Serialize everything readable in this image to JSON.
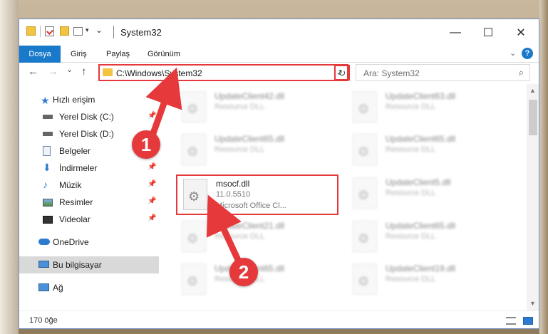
{
  "window": {
    "title": "System32",
    "minimize": "—",
    "maximize": "☐",
    "close": "✕"
  },
  "ribbon": {
    "tabs": [
      "Dosya",
      "Giriş",
      "Paylaş",
      "Görünüm"
    ],
    "active_tab": "Dosya",
    "expand_chevron": "⌄",
    "help": "?"
  },
  "navigation": {
    "back": "←",
    "forward": "→",
    "recent": "⌄",
    "up": "↑",
    "address_path": "C:\\Windows\\System32",
    "address_chevron": "⌄",
    "refresh": "↻",
    "search_placeholder": "Ara: System32",
    "search_icon": "⌕"
  },
  "sidebar": {
    "items": [
      {
        "label": "Hızlı erişim",
        "icon": "star-icon",
        "pinned": false
      },
      {
        "label": "Yerel Disk (C:)",
        "icon": "drive-icon",
        "pinned": true
      },
      {
        "label": "Yerel Disk (D:)",
        "icon": "drive-icon",
        "pinned": true
      },
      {
        "label": "Belgeler",
        "icon": "document-icon",
        "pinned": true
      },
      {
        "label": "İndirmeler",
        "icon": "download-icon",
        "pinned": true
      },
      {
        "label": "Müzik",
        "icon": "music-icon",
        "pinned": true
      },
      {
        "label": "Resimler",
        "icon": "pictures-icon",
        "pinned": true
      },
      {
        "label": "Videolar",
        "icon": "video-icon",
        "pinned": true
      },
      {
        "label": "OneDrive",
        "icon": "cloud-icon",
        "pinned": false
      },
      {
        "label": "Bu bilgisayar",
        "icon": "computer-icon",
        "pinned": false,
        "selected": true
      },
      {
        "label": "Ağ",
        "icon": "network-icon",
        "pinned": false
      }
    ],
    "pin_glyph": "📌"
  },
  "files": {
    "left_column": [
      {
        "name": "UpdateClient42.dll",
        "type": "Resource DLL"
      },
      {
        "name": "UpdateClient65.dll",
        "type": "Resource DLL"
      },
      {
        "name": "msocf.dll",
        "version": "11.0.5510",
        "description": "Microsoft Office Cl...",
        "highlighted": true
      },
      {
        "name": "UpdateClient21.dll",
        "type": "Resource DLL"
      },
      {
        "name": "UpdateClient65.dll",
        "type": "Resource DLL"
      }
    ],
    "right_column": [
      {
        "name": "UpdateClient63.dll",
        "type": "Resource DLL"
      },
      {
        "name": "UpdateClient65.dll",
        "type": "Resource DLL"
      },
      {
        "name": "UpdateClient5.dll",
        "type": "Resource DLL"
      },
      {
        "name": "UpdateClient65.dll",
        "type": "Resource DLL"
      },
      {
        "name": "UpdateClient19.dll",
        "type": "Resource DLL"
      }
    ]
  },
  "status": {
    "item_count": "170 öğe"
  },
  "callouts": {
    "step1": "1",
    "step2": "2",
    "color": "#e5393c"
  }
}
